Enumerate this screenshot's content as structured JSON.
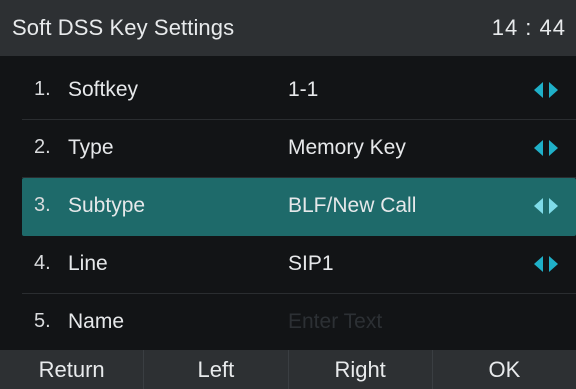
{
  "header": {
    "title": "Soft DSS Key Settings",
    "time": "14 : 44"
  },
  "rows": [
    {
      "index": "1.",
      "label": "Softkey",
      "value": "1-1"
    },
    {
      "index": "2.",
      "label": "Type",
      "value": "Memory Key"
    },
    {
      "index": "3.",
      "label": "Subtype",
      "value": "BLF/New Call"
    },
    {
      "index": "4.",
      "label": "Line",
      "value": "SIP1"
    },
    {
      "index": "5.",
      "label": "Name",
      "placeholder": "Enter Text"
    }
  ],
  "softkeys": [
    "Return",
    "Left",
    "Right",
    "OK"
  ],
  "colors": {
    "selected_row": "#1e6a6a",
    "arrow": "#1fb0c8",
    "header": "#2d3033",
    "background": "#121416"
  }
}
